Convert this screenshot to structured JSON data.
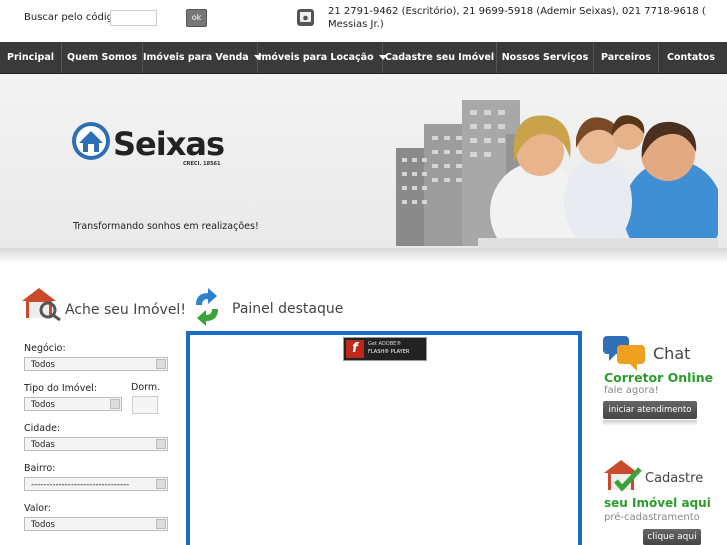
{
  "search": {
    "label": "Buscar pelo código:",
    "value": "",
    "button": "ok"
  },
  "contact": {
    "phones": "21 2791-9462 (Escritório), 21 9699-5918 (Ademir Seixas), 021 7718-9618 ( Messias Jr.)"
  },
  "nav": {
    "items": [
      {
        "label": "Principal"
      },
      {
        "label": "Quem Somos"
      },
      {
        "label": "Imóveis para Venda"
      },
      {
        "label": "Imóveis para Locação"
      },
      {
        "label": "Cadastre seu Imóvel"
      },
      {
        "label": "Nossos Serviços"
      },
      {
        "label": "Parceiros"
      },
      {
        "label": "Contatos"
      }
    ]
  },
  "banner": {
    "logo_text": "Seixas",
    "logo_creci": "CRECI. 18561",
    "tagline": "Transformando sonhos em realizações!"
  },
  "finder": {
    "title": "Ache seu Imóvel!",
    "negocio_label": "Negócio:",
    "negocio_value": "Todos",
    "tipo_label": "Tipo do Imóvel:",
    "tipo_value": "Todos",
    "dorm_label": "Dorm.",
    "cidade_label": "Cidade:",
    "cidade_value": "Todas",
    "bairro_label": "Bairro:",
    "bairro_value": "--------------------------------",
    "valor_label": "Valor:",
    "valor_value": "Todos"
  },
  "painel": {
    "title": "Painel destaque",
    "flash_get": "Get ADOBE®",
    "flash_player": "FLASH® PLAYER"
  },
  "chat": {
    "title": "Chat",
    "subtitle": "Corretor Online",
    "tagline": "fale agora!",
    "button": "iniciar atendimento"
  },
  "cadastre": {
    "title": "Cadastre",
    "subtitle": "seu Imóvel aqui",
    "tagline": "pré-cadastramento",
    "button": "clique aqui"
  },
  "colors": {
    "nav_bg": "#3a3a3a",
    "accent_green": "#2a9d2a",
    "flash_border": "#1a6bc4",
    "logo_blue": "#2d6fb5"
  }
}
